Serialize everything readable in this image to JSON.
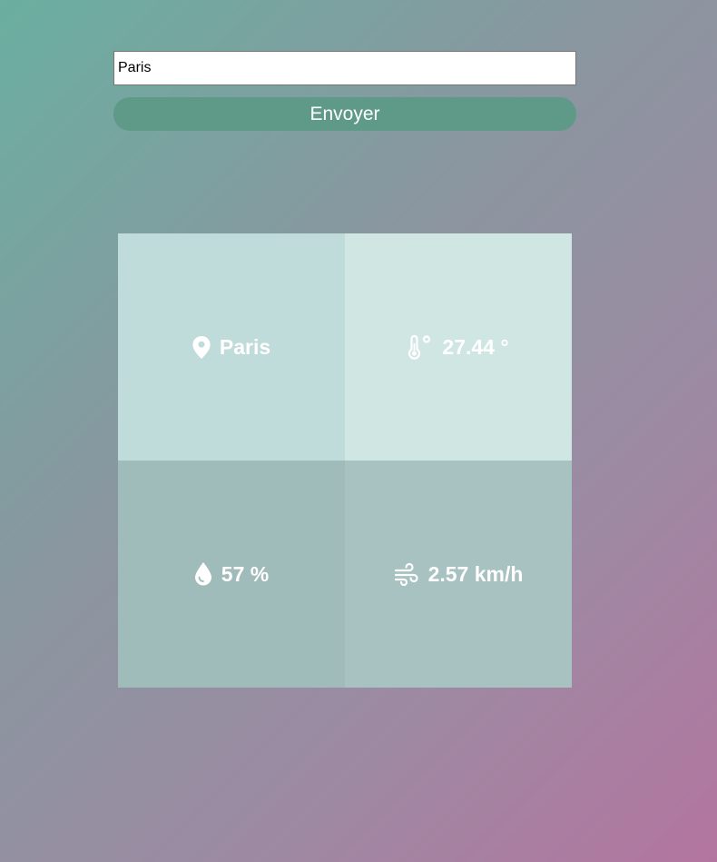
{
  "search": {
    "value": "Paris",
    "button_label": "Envoyer"
  },
  "weather": {
    "city": "Paris",
    "temperature": "27.44 °",
    "humidity": "57 %",
    "wind": "2.57 km/h"
  },
  "icons": {
    "city": "location-pin-icon",
    "temperature": "thermometer-icon",
    "humidity": "water-drop-icon",
    "wind": "wind-icon"
  },
  "colors": {
    "button": "#5f9a88",
    "city_cell": "#c0dcda",
    "temperature_cell": "#d0e6e2",
    "humidity_cell": "#9fbbba",
    "wind_cell": "#a7c2c1"
  }
}
